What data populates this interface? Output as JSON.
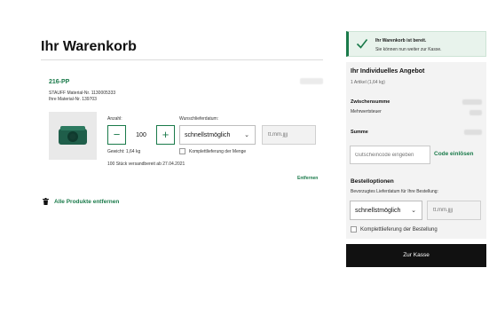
{
  "cart": {
    "title": "Ihr Warenkorb",
    "remove_all_label": "Alle Produkte entfernen"
  },
  "item": {
    "name": "216-PP",
    "stauff_material": "STAUFF Material-Nr. 1130005333",
    "own_material": "Ihre Material-Nr. 139703",
    "quantity_label": "Anzahl:",
    "quantity_value": "100",
    "delivery_label": "Wunschlieferdatum:",
    "delivery_option": "schnellstmöglich",
    "date_placeholder": "tt.mm.jjjj",
    "weight": "Gewicht: 1,64 kg",
    "complete_delivery_label": "Komplettlieferung der Menge",
    "shipping_note": "100 Stück versandbereit ab 27.04.2021",
    "remove_label": "Entfernen",
    "image_icon": "pipe-clamp-product-image"
  },
  "notice": {
    "title": "Ihr Warenkorb ist bereit.",
    "text": "Sie können nun weiter zur Kasse.",
    "icon": "check-icon"
  },
  "offer": {
    "title": "Ihr Individuelles Angebot",
    "count": "1 Artikel (1,64 kg)",
    "subtotal_label": "Zwischensumme",
    "tax_label": "Mehrwertsteuer",
    "total_label": "Summe",
    "coupon_placeholder": "Gutscheincode eingeben",
    "coupon_link": "Code einlösen"
  },
  "order_options": {
    "title": "Bestelloptionen",
    "preferred_date_label": "Bevorzugtes Lieferdatum für Ihre Bestellung:",
    "delivery_option": "schnellstmöglich",
    "date_placeholder": "tt.mm.jjjj",
    "complete_delivery_label": "Komplettlieferung der Bestellung"
  },
  "checkout_label": "Zur Kasse",
  "colors": {
    "accent": "#1a7a4a",
    "notice_bg": "#e8f3ec",
    "panel_bg": "#f3f3f3",
    "button_bg": "#111111"
  }
}
